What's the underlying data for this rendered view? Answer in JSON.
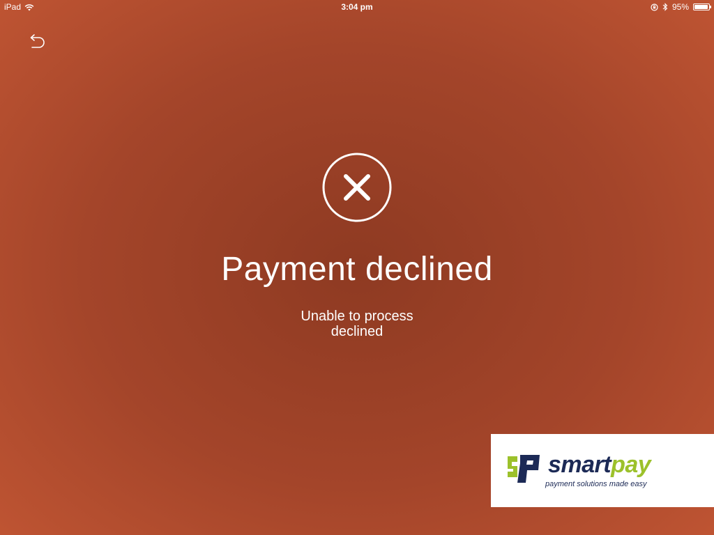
{
  "status_bar": {
    "device": "iPad",
    "time": "3:04 pm",
    "battery_percent": "95%",
    "battery_level": 0.95,
    "icons": [
      "wifi-icon",
      "orientation-lock-icon",
      "bluetooth-icon",
      "battery-icon"
    ]
  },
  "navigation": {
    "back_icon": "back-arrow-icon"
  },
  "result": {
    "icon": "close-circle-icon",
    "title": "Payment declined",
    "message_line1": "Unable to process",
    "message_line2": "declined"
  },
  "logo": {
    "brand_part1": "smart",
    "brand_part2": "pay",
    "tagline": "payment solutions made easy",
    "colors": {
      "navy": "#1c2a56",
      "green": "#9cc12b"
    }
  },
  "colors": {
    "background_center": "#8e3a22",
    "background_edge": "#c05533",
    "foreground": "#ffffff"
  }
}
